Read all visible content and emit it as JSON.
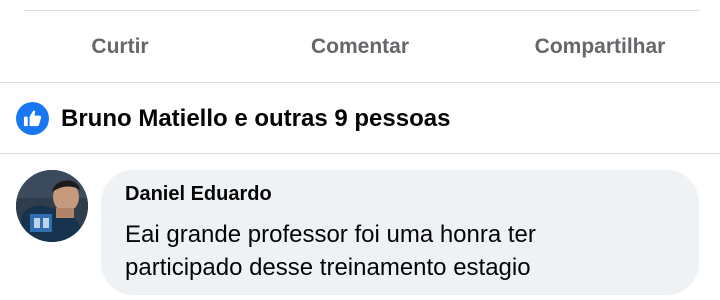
{
  "actions": {
    "like_label": "Curtir",
    "comment_label": "Comentar",
    "share_label": "Compartilhar"
  },
  "reactions": {
    "icon": "thumbs-up-icon",
    "summary": "Bruno Matiello e outras 9 pessoas"
  },
  "comment": {
    "author": "Daniel Eduardo",
    "line1": "Eai grande professor foi uma honra ter",
    "line2": "participado desse treinamento estagio"
  },
  "colors": {
    "accent": "#1877f2",
    "action_text": "#65676b",
    "bubble_bg": "#eff2f5",
    "divider": "#dadde1"
  }
}
